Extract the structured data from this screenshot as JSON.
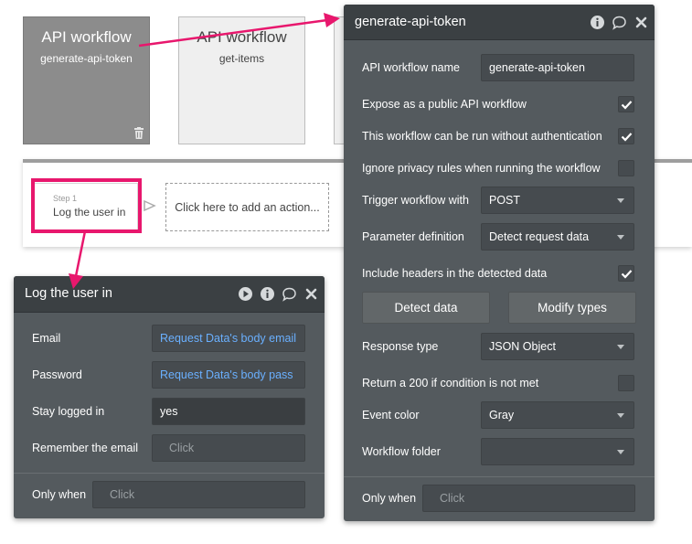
{
  "workflows": [
    {
      "title": "API workflow",
      "subtitle": "generate-api-token"
    },
    {
      "title": "API workflow",
      "subtitle": "get-items"
    }
  ],
  "steps": {
    "step_number": "Step 1",
    "step_name": "Log the user in",
    "add_action": "Click here to add an action..."
  },
  "login_panel": {
    "title": "Log the user in",
    "email_label": "Email",
    "email_value": "Request Data's body email",
    "password_label": "Password",
    "password_value": "Request Data's body pass",
    "stay_logged_label": "Stay logged in",
    "stay_logged_value": "yes",
    "remember_label": "Remember the email",
    "remember_placeholder": "Click",
    "only_when_label": "Only when",
    "only_when_placeholder": "Click"
  },
  "api_panel": {
    "title": "generate-api-token",
    "name_label": "API workflow name",
    "name_value": "generate-api-token",
    "expose_label": "Expose as a public API workflow",
    "expose_checked": true,
    "no_auth_label": "This workflow can be run without authentication",
    "no_auth_checked": true,
    "ignore_privacy_label": "Ignore privacy rules when running the workflow",
    "ignore_privacy_checked": false,
    "trigger_label": "Trigger workflow with",
    "trigger_value": "POST",
    "param_label": "Parameter definition",
    "param_value": "Detect request data",
    "headers_label": "Include headers in the detected data",
    "headers_checked": true,
    "detect_button": "Detect data",
    "modify_button": "Modify types",
    "response_label": "Response type",
    "response_value": "JSON Object",
    "return200_label": "Return a 200 if condition is not met",
    "return200_checked": false,
    "event_color_label": "Event color",
    "event_color_value": "Gray",
    "folder_label": "Workflow folder",
    "folder_value": "",
    "only_when_label": "Only when",
    "only_when_placeholder": "Click"
  },
  "colors": {
    "accent_pink": "#e8176d",
    "panel_bg": "#545a5e",
    "panel_header": "#3b4043",
    "link_blue": "#6ab0ff"
  },
  "icons": [
    "trash-icon",
    "info-icon",
    "comment-icon",
    "close-icon",
    "play-icon",
    "chevron-right-icon",
    "checkmark-icon"
  ]
}
